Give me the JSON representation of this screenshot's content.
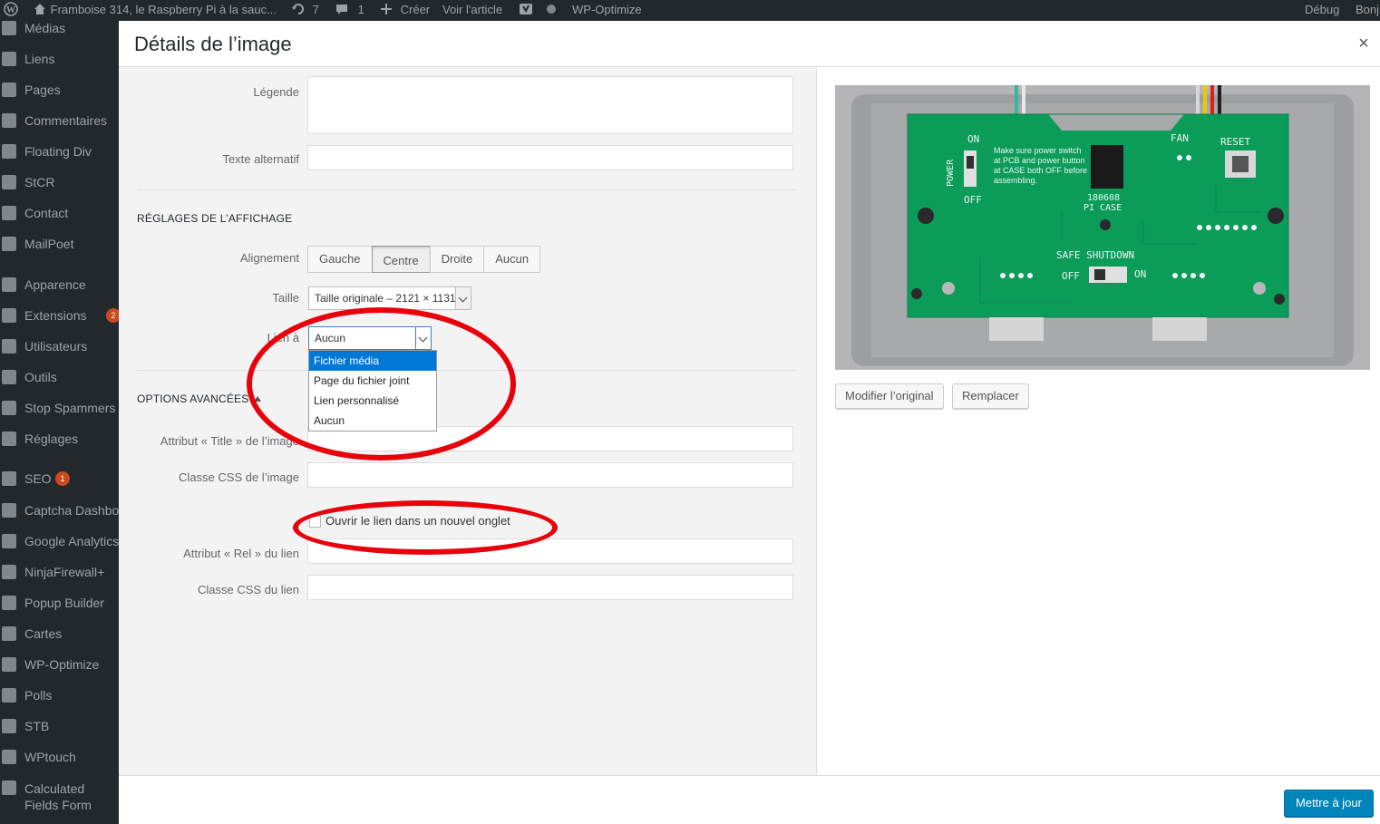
{
  "adminbar": {
    "site_name": "Framboise 314, le Raspberry Pi à la sauc...",
    "updates_count": "7",
    "comments_count": "1",
    "new_label": "Créer",
    "view_label": "Voir l'article",
    "wpo_label": "WP-Optimize",
    "debug_label": "Débug",
    "greeting": "Bonj"
  },
  "sidebar": {
    "items": [
      {
        "label": "Médias",
        "icon": "media-icon"
      },
      {
        "label": "Liens",
        "icon": "links-icon"
      },
      {
        "label": "Pages",
        "icon": "pages-icon"
      },
      {
        "label": "Commentaires",
        "icon": "comments-icon"
      },
      {
        "label": "Floating Div",
        "icon": "plus-icon"
      },
      {
        "label": "StCR",
        "icon": "mail-icon"
      },
      {
        "label": "Contact",
        "icon": "mail-icon"
      },
      {
        "label": "MailPoet",
        "icon": "mailpoet-icon"
      },
      {
        "label": "Apparence",
        "icon": "brush-icon"
      },
      {
        "label": "Extensions",
        "icon": "plugin-icon",
        "badge": "2"
      },
      {
        "label": "Utilisateurs",
        "icon": "users-icon"
      },
      {
        "label": "Outils",
        "icon": "tools-icon"
      },
      {
        "label": "Stop Spammers",
        "icon": "stop-icon"
      },
      {
        "label": "Réglages",
        "icon": "settings-icon"
      },
      {
        "label": "SEO",
        "icon": "yoast-icon",
        "badge": "1"
      },
      {
        "label": "Captcha Dashboard",
        "icon": "gear-icon"
      },
      {
        "label": "Google Analytics",
        "icon": "chart-icon"
      },
      {
        "label": "NinjaFirewall+",
        "icon": "ninja-icon"
      },
      {
        "label": "Popup Builder",
        "icon": "popup-icon"
      },
      {
        "label": "Cartes",
        "icon": "map-icon"
      },
      {
        "label": "WP-Optimize",
        "icon": "wpo-icon"
      },
      {
        "label": "Polls",
        "icon": "polls-icon"
      },
      {
        "label": "STB",
        "icon": "stb-icon"
      },
      {
        "label": "WPtouch",
        "icon": "wptouch-icon"
      },
      {
        "label": "Calculated Fields Form",
        "icon": "gear-icon"
      }
    ]
  },
  "modal": {
    "title": "Détails de l’image",
    "close_symbol": "×",
    "legende_label": "Légende",
    "legende_value": "",
    "alt_label": "Texte alternatif",
    "alt_value": "",
    "display_settings_title": "Réglages de l’affichage",
    "alignment_label": "Alignement",
    "alignment_options": [
      "Gauche",
      "Centre",
      "Droite",
      "Aucun"
    ],
    "alignment_selected": "Centre",
    "size_label": "Taille",
    "size_value": "Taille originale – 2121 × 1131",
    "link_label": "Lien à",
    "link_value": "Aucun",
    "link_options": [
      "Fichier média",
      "Page du fichier joint",
      "Lien personnalisé",
      "Aucun"
    ],
    "link_highlighted": "Fichier média",
    "advanced_title": "Options avancées",
    "title_attr_label": "Attribut « Title » de l’image",
    "title_attr_value": "",
    "img_css_label": "Classe CSS de l’image",
    "img_css_value": "",
    "newtab_label": "Ouvrir le lien dans un nouvel onglet",
    "newtab_checked": false,
    "rel_label": "Attribut « Rel » du lien",
    "rel_value": "",
    "link_css_label": "Classe CSS du lien",
    "link_css_value": "",
    "edit_original_label": "Modifier l’original",
    "replace_label": "Remplacer",
    "update_label": "Mettre à jour"
  },
  "pcb": {
    "on": "ON",
    "off": "OFF",
    "power": "POWER",
    "note": [
      "Make sure power switch",
      "at PCB and power button",
      "at CASE both OFF before",
      "assembling."
    ],
    "fan": "FAN",
    "reset": "RESET",
    "model": [
      "180608",
      "PI CASE"
    ],
    "safe_shutdown": "SAFE SHUTDOWN",
    "shutdown_off": "OFF",
    "shutdown_on": "ON"
  },
  "colors": {
    "admin_bg": "#23282d",
    "accent_blue": "#0085ba",
    "annotation_red": "#e8000b",
    "pcb_green": "#0c9c5a",
    "dropdown_highlight": "#0078d7"
  }
}
